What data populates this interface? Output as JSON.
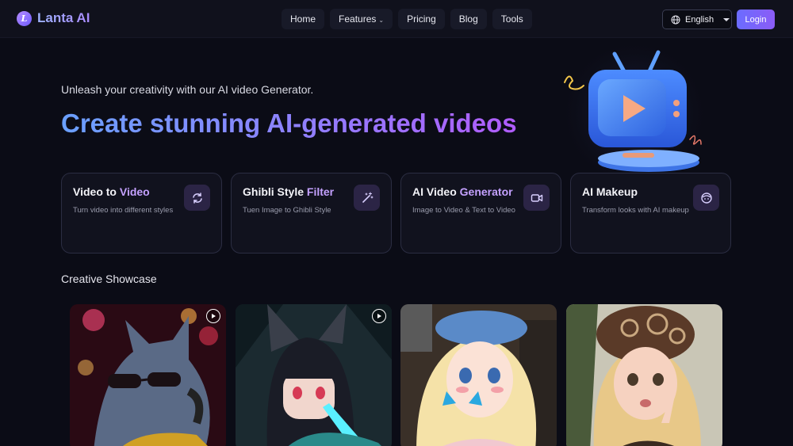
{
  "brand": {
    "name": "Lanta AI",
    "logo_letter": "L"
  },
  "nav": {
    "items": [
      {
        "label": "Home"
      },
      {
        "label": "Features",
        "has_dropdown": true
      },
      {
        "label": "Pricing"
      },
      {
        "label": "Blog"
      },
      {
        "label": "Tools"
      }
    ],
    "language": "English",
    "login_label": "Login"
  },
  "hero": {
    "tagline": "Unleash your creativity with our AI video Generator.",
    "headline": "Create stunning AI-generated videos"
  },
  "cards": [
    {
      "title_a": "Video to ",
      "title_b": "Video",
      "subtitle": "Turn video into different styles",
      "icon": "refresh-icon"
    },
    {
      "title_a": "Ghibli Style ",
      "title_b": "Filter",
      "subtitle": "Tuen Image to Ghibli Style",
      "icon": "magic-wand-icon"
    },
    {
      "title_a": "AI Video ",
      "title_b": "Generator",
      "subtitle": "Image to Video & Text to Video",
      "icon": "video-camera-icon"
    },
    {
      "title_a": "AI Makeup",
      "title_b": "",
      "subtitle": "Transform looks with AI makeup",
      "icon": "face-icon"
    }
  ],
  "showcase": {
    "title": "Creative Showcase",
    "items": [
      {
        "subject": "cat-with-sunglasses",
        "has_play": true
      },
      {
        "subject": "anime-fox-girl",
        "has_play": true
      },
      {
        "subject": "anime-girl-with-butterfly",
        "has_play": false
      },
      {
        "subject": "girl-with-headscarf",
        "has_play": false
      }
    ]
  },
  "colors": {
    "accent": "#8b5cf6",
    "highlight": "#c4a1ff",
    "background": "#0b0c16"
  }
}
